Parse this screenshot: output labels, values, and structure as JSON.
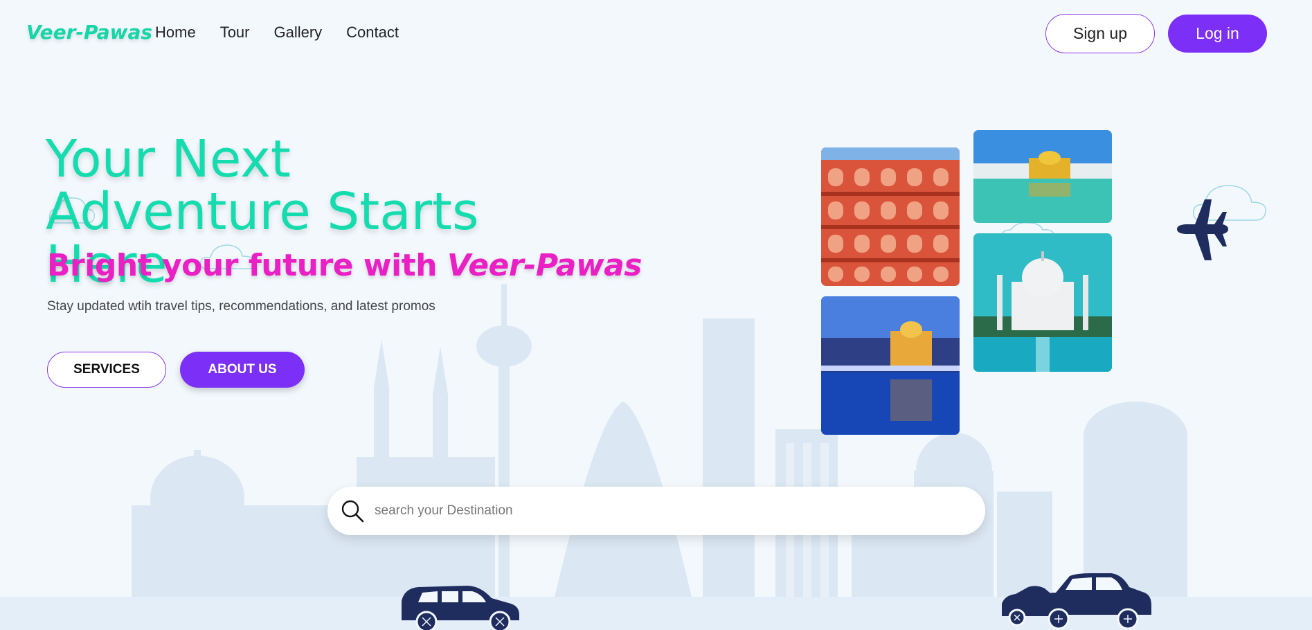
{
  "nav": {
    "logo": "Veer-Pawas",
    "links": [
      "Home",
      "Tour",
      "Gallery",
      "Contact"
    ],
    "signup_label": "Sign up",
    "login_label": "Log in"
  },
  "hero": {
    "title": "Your Next Adventure Starts Here",
    "subtitle_prefix": "Bright your future with ",
    "subtitle_brand": "Veer-Pawas",
    "description": "Stay updated wtih travel tips, recommendations, and latest promos",
    "services_label": "SERVICES",
    "about_label": "ABOUT US"
  },
  "gallery": {
    "images": [
      "hawa-mahal",
      "golden-temple-day",
      "taj-mahal",
      "golden-temple-night"
    ]
  },
  "search": {
    "placeholder": "search your Destination",
    "icon": "search-icon"
  },
  "decor": {
    "airplane": "airplane-icon",
    "cars": [
      "hatchback-car-icon",
      "cars-group-icon"
    ]
  },
  "colors": {
    "accent": "#7b2ff7",
    "brand": "#14d6a6",
    "highlight": "#ea1fc4",
    "background": "#f3f8fd",
    "navy": "#1f2c5e"
  }
}
